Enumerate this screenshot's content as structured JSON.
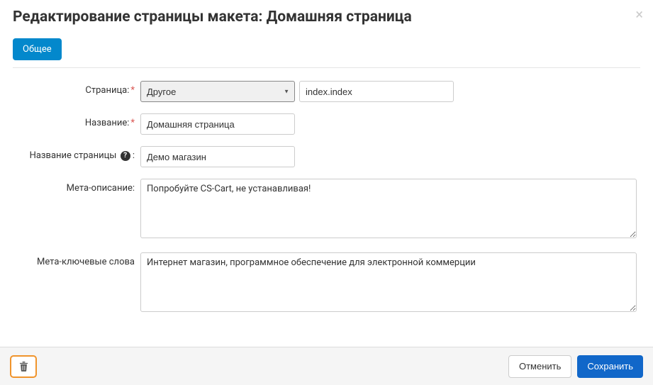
{
  "header": {
    "title": "Редактирование страницы макета: Домашняя страница"
  },
  "tabs": {
    "general": "Общее"
  },
  "form": {
    "page": {
      "label": "Страница:",
      "selected": "Другое",
      "dispatch_value": "index.index"
    },
    "name": {
      "label": "Название:",
      "value": "Домашняя страница"
    },
    "page_title": {
      "label": "Название страницы",
      "value": "Демо магазин"
    },
    "meta_desc": {
      "label": "Мета-описание:",
      "value": "Попробуйте CS-Cart, не устанавливая!"
    },
    "meta_keywords": {
      "label": "Мета-ключевые слова",
      "value": "Интернет магазин, программное обеспечение для электронной коммерции"
    }
  },
  "footer": {
    "cancel": "Отменить",
    "save": "Сохранить"
  }
}
